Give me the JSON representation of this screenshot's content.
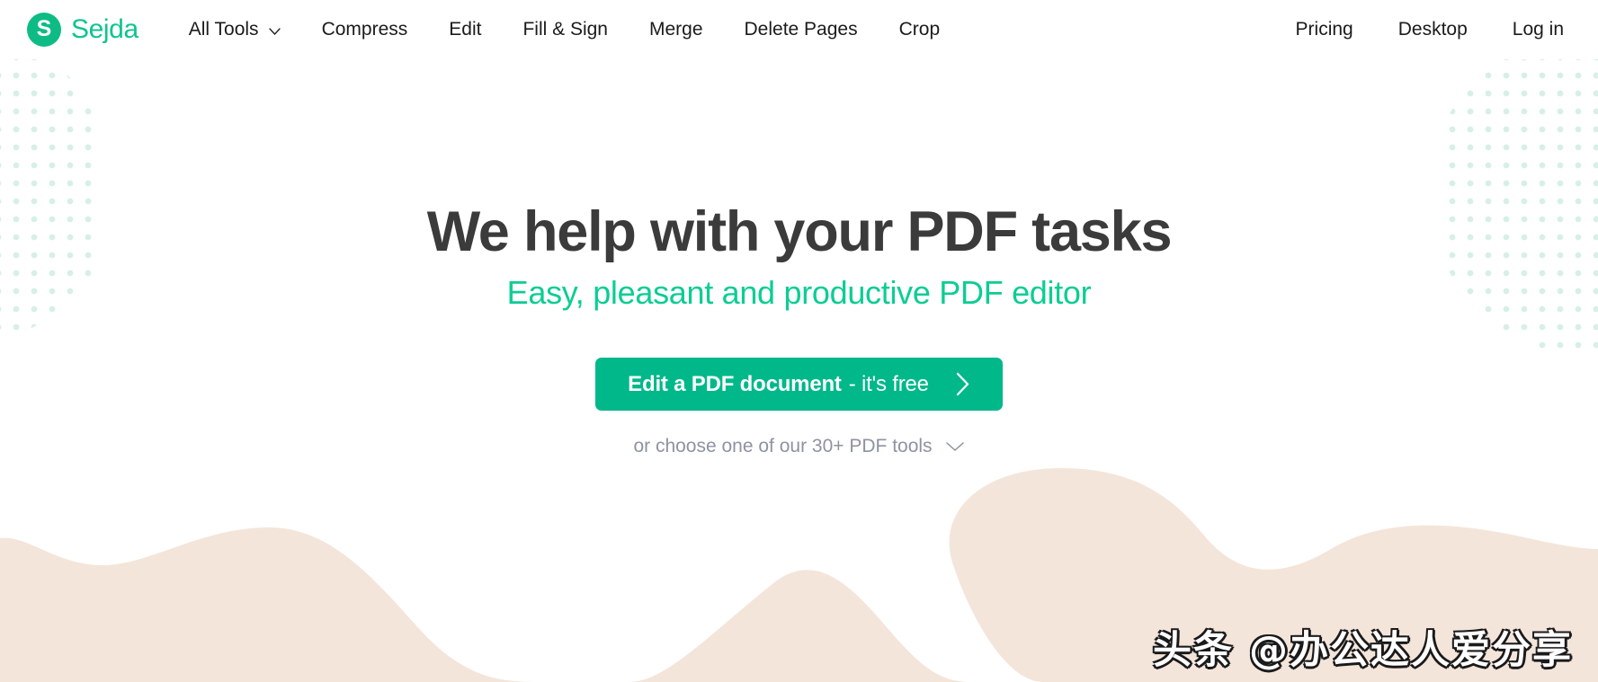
{
  "brand": {
    "mark_letter": "S",
    "name": "Sejda",
    "mark_color": "#0ebb85",
    "name_color": "#0fc48e"
  },
  "nav": {
    "main": [
      {
        "label": "All Tools",
        "has_caret": true
      },
      {
        "label": "Compress",
        "has_caret": false
      },
      {
        "label": "Edit",
        "has_caret": false
      },
      {
        "label": "Fill & Sign",
        "has_caret": false
      },
      {
        "label": "Merge",
        "has_caret": false
      },
      {
        "label": "Delete Pages",
        "has_caret": false
      },
      {
        "label": "Crop",
        "has_caret": false
      }
    ],
    "right": [
      {
        "label": "Pricing"
      },
      {
        "label": "Desktop"
      },
      {
        "label": "Log in"
      }
    ]
  },
  "hero": {
    "title": "We help with your PDF tasks",
    "subtitle": "Easy, pleasant and productive PDF editor",
    "title_color": "#3b3b3b",
    "subtitle_color": "#0ccd93",
    "cta": {
      "strong": "Edit a PDF document",
      "light": "- it's free",
      "bg_color": "#00b88a",
      "icon": "chevron-right-icon"
    },
    "choose": {
      "label": "or choose one of our 30+ PDF tools",
      "icon": "chevron-down-icon",
      "color": "#8d93a0"
    }
  },
  "decor": {
    "dot_color": "#d7f0e6",
    "wave_color": "#f4e5da"
  },
  "watermark": {
    "text": "头条 @办公达人爱分享"
  }
}
